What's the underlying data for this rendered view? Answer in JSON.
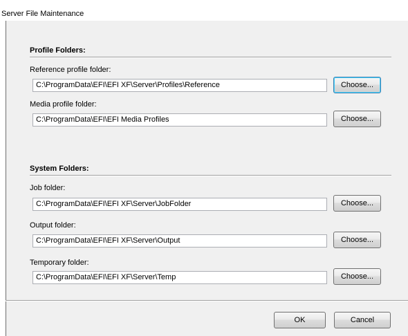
{
  "window": {
    "title": "Server File Maintenance"
  },
  "profile_folders": {
    "heading": "Profile Folders:",
    "reference": {
      "label": "Reference profile folder:",
      "value": "C:\\ProgramData\\EFI\\EFI XF\\Server\\Profiles\\Reference",
      "button": "Choose..."
    },
    "media": {
      "label": "Media profile folder:",
      "value": "C:\\ProgramData\\EFI\\EFI Media Profiles",
      "button": "Choose..."
    }
  },
  "system_folders": {
    "heading": "System Folders:",
    "job": {
      "label": "Job folder:",
      "value": "C:\\ProgramData\\EFI\\EFI XF\\Server\\JobFolder",
      "button": "Choose..."
    },
    "output": {
      "label": "Output folder:",
      "value": "C:\\ProgramData\\EFI\\EFI XF\\Server\\Output",
      "button": "Choose..."
    },
    "temporary": {
      "label": "Temporary folder:",
      "value": "C:\\ProgramData\\EFI\\EFI XF\\Server\\Temp",
      "button": "Choose..."
    }
  },
  "footer": {
    "ok_label": "OK",
    "cancel_label": "Cancel"
  },
  "colors": {
    "client_background": "#f0f0f0",
    "field_border": "#abadb3",
    "focused_button_border": "#3c7fb1"
  }
}
